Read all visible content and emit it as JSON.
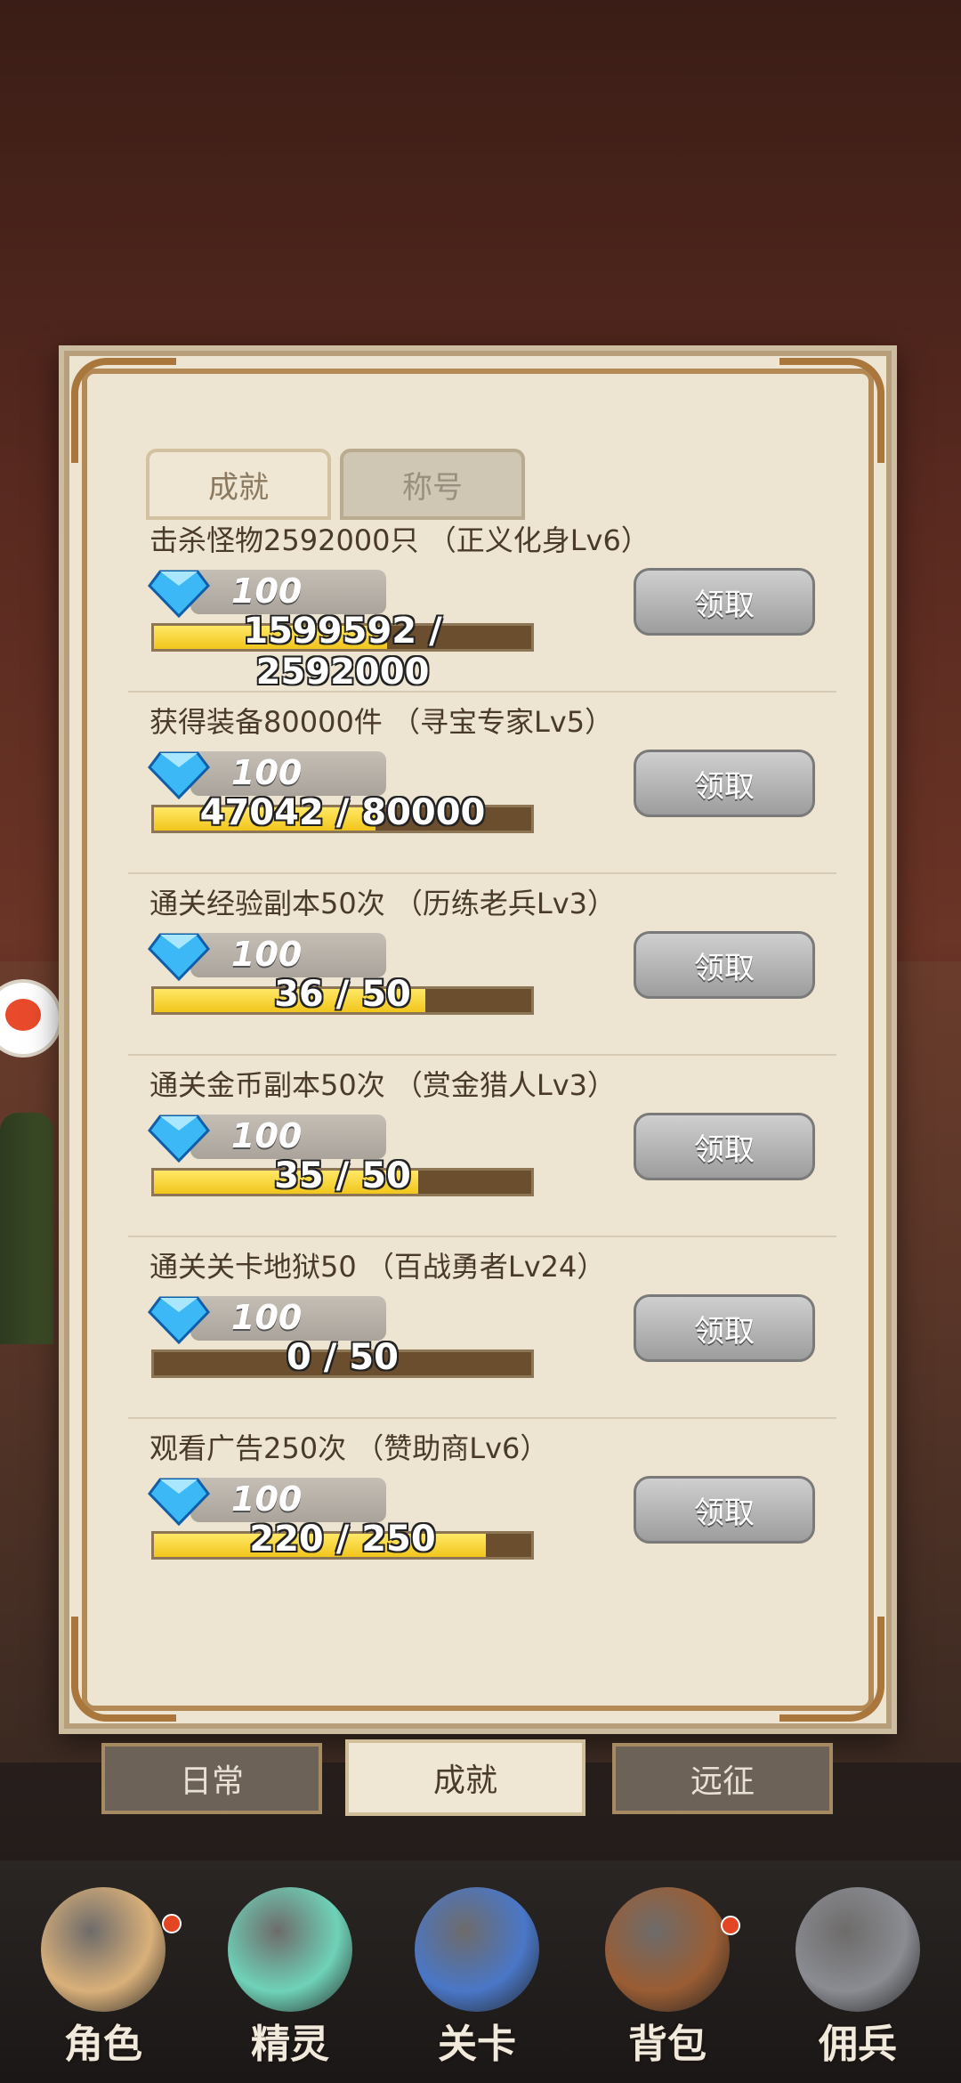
{
  "panel": {
    "tabs": [
      "成就",
      "称号"
    ]
  },
  "achievements": [
    {
      "title": "击杀怪物2592000只 （正义化身Lv6）",
      "reward": "100",
      "progress_text": "1599592 / 2592000",
      "progress": 0.617,
      "claim": "领取"
    },
    {
      "title": "获得装备80000件 （寻宝专家Lv5）",
      "reward": "100",
      "progress_text": "47042 / 80000",
      "progress": 0.588,
      "claim": "领取"
    },
    {
      "title": "通关经验副本50次 （历练老兵Lv3）",
      "reward": "100",
      "progress_text": "36 / 50",
      "progress": 0.72,
      "claim": "领取"
    },
    {
      "title": "通关金币副本50次 （赏金猎人Lv3）",
      "reward": "100",
      "progress_text": "35 / 50",
      "progress": 0.7,
      "claim": "领取"
    },
    {
      "title": "通关关卡地狱50 （百战勇者Lv24）",
      "reward": "100",
      "progress_text": "0 / 50",
      "progress": 0.0,
      "claim": "领取"
    },
    {
      "title": "观看广告250次 （赞助商Lv6）",
      "reward": "100",
      "progress_text": "220 / 250",
      "progress": 0.88,
      "claim": "领取"
    }
  ],
  "sections": [
    "日常",
    "成就",
    "远征"
  ],
  "nav": [
    {
      "label": "角色",
      "icon": "hero-portrait-icon",
      "color": "#d9b07a"
    },
    {
      "label": "精灵",
      "icon": "slime-spirit-icon",
      "color": "#6fd2b8"
    },
    {
      "label": "关卡",
      "icon": "crossed-swords-icon",
      "color": "#4a77c7"
    },
    {
      "label": "背包",
      "icon": "backpack-icon",
      "color": "#9a5d34"
    },
    {
      "label": "佣兵",
      "icon": "knight-helmet-icon",
      "color": "#8a8c92"
    }
  ],
  "colors": {
    "progress_fill": "#f1c61c",
    "gem": "#3bb8f5"
  }
}
